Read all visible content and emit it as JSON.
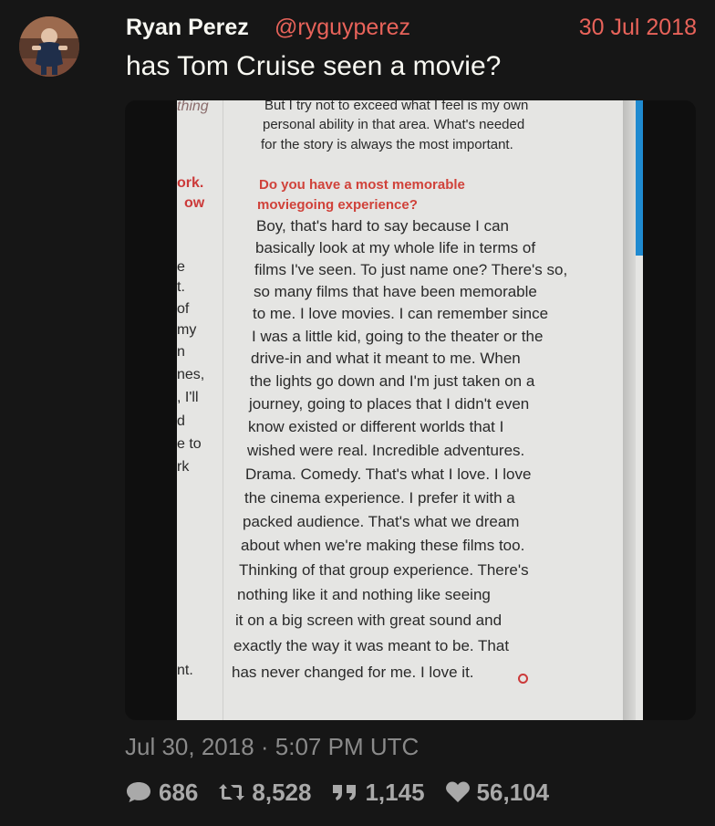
{
  "tweet": {
    "author": {
      "fullname": "Ryan Perez",
      "username": "@ryguyperez"
    },
    "date": "30 Jul 2018",
    "text": "has Tom Cruise seen a movie?",
    "timestamp": "Jul 30, 2018 · 5:07 PM UTC"
  },
  "stats": {
    "replies": "686",
    "retweets": "8,528",
    "quotes": "1,145",
    "likes": "56,104"
  },
  "icons": {
    "replies": "comment-icon",
    "retweets": "retweet-icon",
    "quotes": "quote-icon",
    "likes": "heart-icon"
  },
  "colors": {
    "background": "#161616",
    "accent": "#e8635a",
    "text": "#f8f8f2",
    "muted": "#8a8a8a"
  },
  "media": {
    "left_column_fragments": [
      "thing",
      "ork.",
      "ow",
      "e",
      "t.",
      "of",
      "my",
      "n",
      "nes,",
      ", I'll",
      "d",
      "e to",
      "rk",
      "nt."
    ],
    "lines": [
      "But I try not to exceed what I feel is my own",
      "personal ability in that area. What's needed",
      "for the story is always the most important.",
      "Do you have a most memorable",
      "moviegoing experience?",
      "Boy, that's hard to say because I can",
      "basically look at my whole life in terms of",
      "films I've seen. To just name one? There's so,",
      "so many films that have been memorable",
      "to me. I love movies. I can remember since",
      "I was a little kid, going to the theater or the",
      "drive-in and what it meant to me. When",
      "the lights go down and I'm just taken on a",
      "journey, going to places that I didn't even",
      "know existed or different worlds that I",
      "wished were real. Incredible adventures.",
      "Drama. Comedy. That's what I love. I love",
      "the cinema experience. I prefer it with a",
      "packed audience. That's what we dream",
      "about when we're making these films too.",
      "Thinking of that group experience. There's",
      "nothing like it and nothing like seeing",
      "it on a big screen with great sound and",
      "exactly the way it was meant to be. That",
      "has never changed for me. I love it."
    ]
  }
}
